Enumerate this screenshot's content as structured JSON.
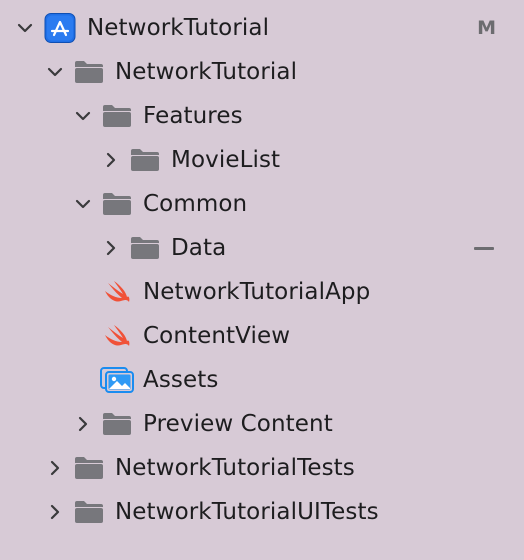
{
  "project": {
    "name": "NetworkTutorial",
    "status": "M",
    "icon": "xcode-project-icon"
  },
  "tree": {
    "app_folder": {
      "label": "NetworkTutorial",
      "expanded": true,
      "icon": "folder-icon"
    },
    "features": {
      "label": "Features",
      "expanded": true,
      "icon": "folder-icon"
    },
    "movielist": {
      "label": "MovieList",
      "expanded": false,
      "icon": "folder-icon"
    },
    "common": {
      "label": "Common",
      "expanded": true,
      "icon": "folder-icon"
    },
    "data": {
      "label": "Data",
      "expanded": false,
      "icon": "folder-icon",
      "status": "removed"
    },
    "app_file": {
      "label": "NetworkTutorialApp",
      "icon": "swift-file-icon"
    },
    "content_view": {
      "label": "ContentView",
      "icon": "swift-file-icon"
    },
    "assets": {
      "label": "Assets",
      "icon": "asset-catalog-icon"
    },
    "preview": {
      "label": "Preview Content",
      "expanded": false,
      "icon": "folder-icon"
    },
    "tests": {
      "label": "NetworkTutorialTests",
      "expanded": false,
      "icon": "folder-icon"
    },
    "ui_tests": {
      "label": "NetworkTutorialUITests",
      "expanded": false,
      "icon": "folder-icon"
    }
  },
  "colors": {
    "background": "#d7cad6",
    "folder": "#77777c",
    "swift": "#f05138",
    "project": "#1f6fe6",
    "status": "#6c6c70"
  }
}
